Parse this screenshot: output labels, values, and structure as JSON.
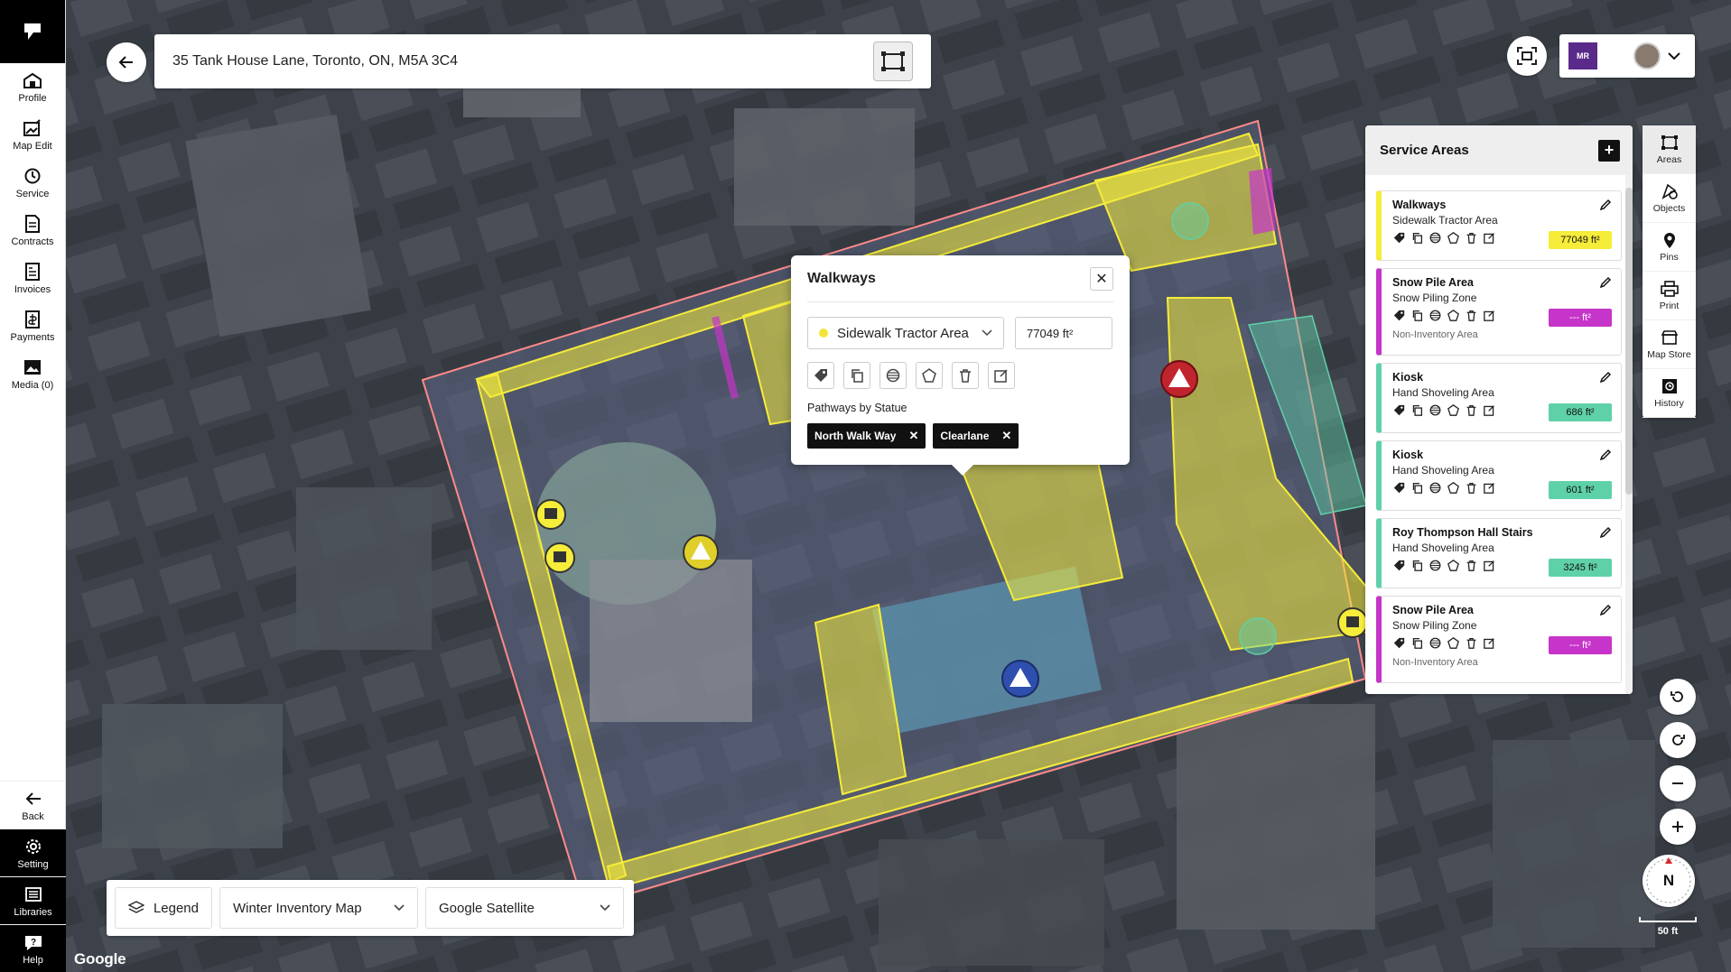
{
  "nav": {
    "items": [
      {
        "label": "Profile",
        "icon": "profile-icon"
      },
      {
        "label": "Map Edit",
        "icon": "map-edit-icon"
      },
      {
        "label": "Service",
        "icon": "service-icon"
      },
      {
        "label": "Contracts",
        "icon": "contracts-icon"
      },
      {
        "label": "Invoices",
        "icon": "invoices-icon"
      },
      {
        "label": "Payments",
        "icon": "payments-icon"
      },
      {
        "label": "Media (0)",
        "icon": "media-icon"
      }
    ],
    "bottom": [
      {
        "label": "Back",
        "icon": "back-arrow-icon"
      },
      {
        "label": "Setting",
        "icon": "gear-icon"
      },
      {
        "label": "Libraries",
        "icon": "libraries-icon"
      },
      {
        "label": "Help",
        "icon": "help-icon"
      }
    ]
  },
  "search": {
    "address": "35 Tank House Lane, Toronto, ON, M5A 3C4"
  },
  "user": {
    "logo_text": "MR"
  },
  "popup": {
    "title": "Walkways",
    "area_type": "Sidewalk Tractor Area",
    "area_value": "77049 ft²",
    "section_label": "Pathways by Statue",
    "tags": [
      "North Walk Way",
      "Clearlane"
    ],
    "close_glyph": "✕"
  },
  "service_areas": {
    "title": "Service Areas",
    "add_glyph": "+",
    "cards": [
      {
        "name": "Walkways",
        "type": "Sidewalk Tractor Area",
        "area": "77049 ft²",
        "color": "#f6ec3a",
        "badge_bg": "#f6ec3a",
        "badge_fg": "#111",
        "note": ""
      },
      {
        "name": "Snow Pile Area",
        "type": "Snow Piling Zone",
        "area": "--- ft²",
        "color": "#c634c9",
        "badge_bg": "#c634c9",
        "badge_fg": "#fff",
        "note": "Non-Inventory Area"
      },
      {
        "name": "Kiosk",
        "type": "Hand Shoveling Area",
        "area": "686 ft²",
        "color": "#5fd1a8",
        "badge_bg": "#5fd1a8",
        "badge_fg": "#111",
        "note": ""
      },
      {
        "name": "Kiosk",
        "type": "Hand Shoveling Area",
        "area": "601 ft²",
        "color": "#5fd1a8",
        "badge_bg": "#5fd1a8",
        "badge_fg": "#111",
        "note": ""
      },
      {
        "name": "Roy Thompson Hall Stairs",
        "type": "Hand Shoveling Area",
        "area": "3245 ft²",
        "color": "#5fd1a8",
        "badge_bg": "#5fd1a8",
        "badge_fg": "#111",
        "note": ""
      },
      {
        "name": "Snow Pile Area",
        "type": "Snow Piling Zone",
        "area": "--- ft²",
        "color": "#c634c9",
        "badge_bg": "#c634c9",
        "badge_fg": "#fff",
        "note": "Non-Inventory Area"
      }
    ]
  },
  "rail": [
    {
      "label": "Areas",
      "icon": "areas-icon"
    },
    {
      "label": "Objects",
      "icon": "objects-icon"
    },
    {
      "label": "Pins",
      "icon": "pin-icon"
    },
    {
      "label": "Print",
      "icon": "print-icon"
    },
    {
      "label": "Map Store",
      "icon": "map-store-icon"
    },
    {
      "label": "History",
      "icon": "history-icon"
    }
  ],
  "compass": {
    "label": "N"
  },
  "scale": {
    "label": "50 ft"
  },
  "bottom_bar": {
    "legend": "Legend",
    "map_select": "Winter Inventory Map",
    "layer_select": "Google Satellite"
  },
  "attribution": "Google",
  "colors": {
    "walkway": "#f6ec3a",
    "snow_pile": "#c634c9",
    "shoveling": "#5fd1a8",
    "boundary": "#ff7b7b",
    "warning_red": "#c0242d",
    "warning_blue": "#2f4fae"
  }
}
